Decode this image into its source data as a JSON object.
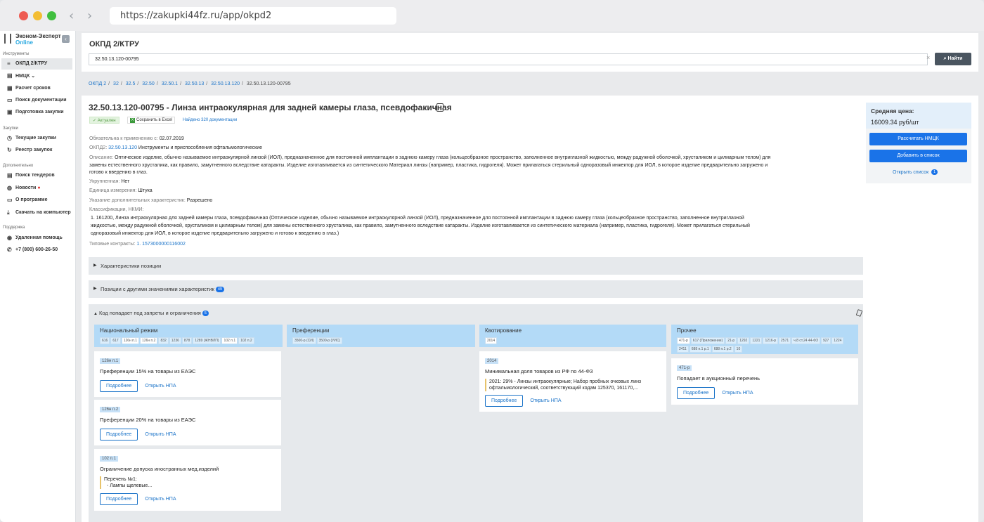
{
  "browser": {
    "url": "https://zakupki44fz.ru/app/okpd2"
  },
  "sidebar": {
    "brand": "Эконом-Эксперт",
    "brand_sub": "Online",
    "sections": {
      "tools": "Инструменты",
      "purchases": "Закупки",
      "extra": "Дополнительно",
      "support": "Поддержка"
    },
    "items": [
      {
        "label": "ОКПД 2/КТРУ"
      },
      {
        "label": "НМЦК"
      },
      {
        "label": "Расчет сроков"
      },
      {
        "label": "Поиск документации"
      },
      {
        "label": "Подготовка закупки"
      },
      {
        "label": "Текущие закупки"
      },
      {
        "label": "Реестр закупок"
      },
      {
        "label": "Поиск тендеров"
      },
      {
        "label": "Новости"
      },
      {
        "label": "О программе"
      },
      {
        "label": "Скачать на компьютер"
      },
      {
        "label": "Удаленная помощь"
      },
      {
        "label": "+7 (800) 600-26-50"
      }
    ]
  },
  "header": {
    "title": "ОКПД 2/КТРУ",
    "search_value": "32.50.13.120-00795",
    "search_button": "Найти"
  },
  "breadcrumbs": [
    "ОКПД 2",
    "32",
    "32.5",
    "32.50",
    "32.50.1",
    "32.50.13",
    "32.50.13.120",
    "32.50.13.120-00795"
  ],
  "item": {
    "title": "32.50.13.120-00795 - Линза интраокулярная для задней камеры глаза, псевдофакичная",
    "status": "✓ Актуален",
    "excel": "Сохранить в Excel",
    "docs": "Найдено 320 документации",
    "mandatory_k": "Обязательна к применению с:",
    "mandatory_v": "02.07.2019",
    "okpd_k": "ОКПД2:",
    "okpd_code": "32.50.13.120",
    "okpd_v": "Инструменты и приспособления офтальмологические",
    "desc_k": "Описание:",
    "desc_v": "Оптическое изделие, обычно называемое интраокулярной линзой (ИОЛ), предназначенное для постоянной имплантации в заднюю камеру глаза (кольцеобразное пространство, заполненное внутриглазной жидкостью, между радужной оболочкой, хрусталиком и цилиарным телом) для",
    "desc_v2": "замены естественного хрусталика, как правило, замутненного вследствие катаракты. Изделие изготавливается из синтетического Материал линзы (например, пластика, гидрогеля). Может прилагаться стерильный одноразовый инжектор для ИОЛ, в которое изделие предварительно загружено и",
    "desc_v3": "готово к введению в глаз.",
    "enl_k": "Укрупненная:",
    "enl_v": "Нет",
    "unit_k": "Единица измерения:",
    "unit_v": "Штука",
    "addchar_k": "Указание дополнительных характеристик:",
    "addchar_v": "Разрешено",
    "class_k": "Классификации, НКМИ:",
    "class_v1": "1. 161200, Линза интраокулярная для задней камеры глаза, псевдофакичная (Оптическое изделие, обычно называемое интраокулярной линзой (ИОЛ), предназначенное для постоянной имплантации в заднюю камеру глаза (кольцеобразное пространство, заполненное внутриглазной",
    "class_v2": "жидкостью, между радужной оболочкой, хрусталиком и цилиарным телом) для замены естественного хрусталика, как правило, замутненного вследствие катаракты. Изделие изготавливается из синтетического материала (например, пластика, гидрогеля). Может прилагаться стерильный",
    "class_v3": "одноразовый инжектор для ИОЛ, в которое изделие предварительно загружено и готово к введению в глаз.)",
    "typical_k": "Типовые контракты:",
    "typical_v": "1. 1573000000116002"
  },
  "accordions": {
    "chars": "Характеристики позиции",
    "other": "Позиции с другими значениями характеристик",
    "other_count": "49",
    "bans": "Код попадает под запреты и ограничения",
    "bans_count": "5"
  },
  "columns": {
    "national": {
      "title": "Национальный режим",
      "tags": [
        "616",
        "617",
        "126н п.1",
        "126н п.2",
        "832",
        "1236",
        "878",
        "1289 (ЖНВЛП)",
        "102 п.1",
        "102 п.2"
      ]
    },
    "pref": {
      "title": "Преференции",
      "tags": [
        "3500-р (СИ)",
        "3500-р (УИС)"
      ]
    },
    "quota": {
      "title": "Квотирование",
      "tags": [
        "2014"
      ]
    },
    "other": {
      "title": "Прочее",
      "tags": [
        "471-р",
        "617 (Приложение)",
        "21-р",
        "1292",
        "1221",
        "1216-р",
        "2571",
        "ч.8 ст.24 44-ФЗ",
        "927",
        "1224",
        "2411",
        "688 п.1 р.1",
        "688 п.1 р.2",
        "10"
      ]
    }
  },
  "cards": {
    "c1": {
      "tag": "126н п.1",
      "title": "Преференции 15% на товары из ЕАЭС"
    },
    "c2": {
      "tag": "126н п.2",
      "title": "Преференции 20% на товары из ЕАЭС"
    },
    "c3": {
      "tag": "102 п.1",
      "title": "Ограничение допуска иностранных мед.изделий",
      "q1": "Перечень №1:",
      "q2": "- Лампы щелевые..."
    },
    "c4": {
      "tag": "2014",
      "title": "Минимальная доля товаров из РФ по 44-ФЗ",
      "q1": "2021: 29% - Линзы интраокулярные; Набор пробных очковых линз",
      "q2": "офтальмологический, соответствующий кодам 125370, 161170,..."
    },
    "c5": {
      "tag": "471-р",
      "title": "Попадает в аукционный перечень"
    },
    "more": "Подробнее",
    "npa": "Открыть НПА"
  },
  "side": {
    "price_title": "Средняя цена:",
    "price_value": "16009.34 руб/шт",
    "calc": "Рассчитать НМЦК",
    "add": "Добавить в список",
    "open": "Открыть список",
    "open_count": "1"
  }
}
